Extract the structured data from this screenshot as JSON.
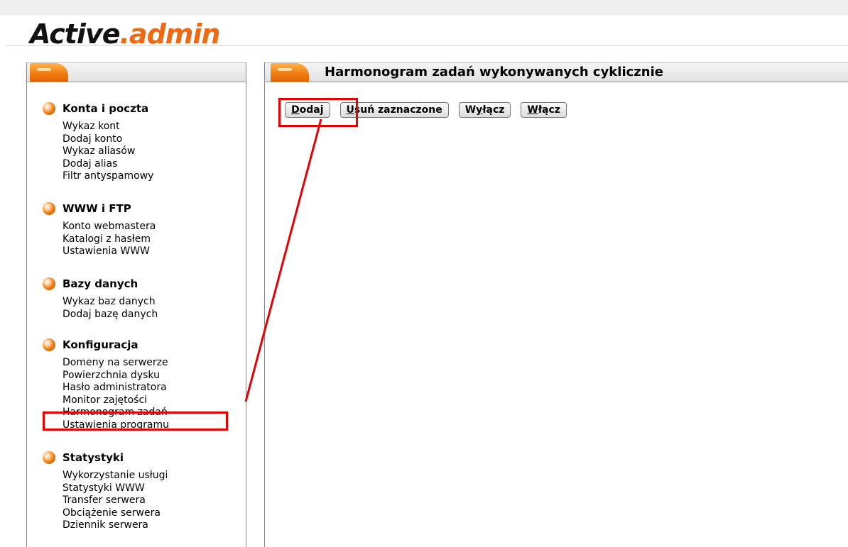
{
  "logo": {
    "part1": "Active",
    "part2": ".admin"
  },
  "main": {
    "title": "Harmonogram zadań wykonywanych cyklicznie"
  },
  "toolbar": {
    "buttons": [
      {
        "label": "Dodaj",
        "accesskey": "D"
      },
      {
        "label": "Usuń zaznaczone",
        "accesskey": "U"
      },
      {
        "label": "Wyłącz",
        "accesskey": "y"
      },
      {
        "label": "Włącz",
        "accesskey": "W"
      }
    ]
  },
  "sidebar": {
    "sections": [
      {
        "title": "Konta i poczta",
        "items": [
          "Wykaz kont",
          "Dodaj konto",
          "Wykaz aliasów",
          "Dodaj alias",
          "Filtr antyspamowy"
        ]
      },
      {
        "title": "WWW i FTP",
        "items": [
          "Konto webmastera",
          "Katalogi z hasłem",
          "Ustawienia WWW"
        ]
      },
      {
        "title": "Bazy danych",
        "items": [
          "Wykaz baz danych",
          "Dodaj bazę danych"
        ]
      },
      {
        "title": "Konfiguracja",
        "items": [
          "Domeny na serwerze",
          "Powierzchnia dysku",
          "Hasło administratora",
          "Monitor zajętości",
          "Harmonogram zadań",
          "Ustawienia programu"
        ]
      },
      {
        "title": "Statystyki",
        "items": [
          "Wykorzystanie usługi",
          "Statystyki WWW",
          "Transfer serwera",
          "Obciążenie serwera",
          "Dziennik serwera"
        ]
      }
    ]
  },
  "colors": {
    "accent": "#ee6a12",
    "highlight": "#e60000"
  }
}
